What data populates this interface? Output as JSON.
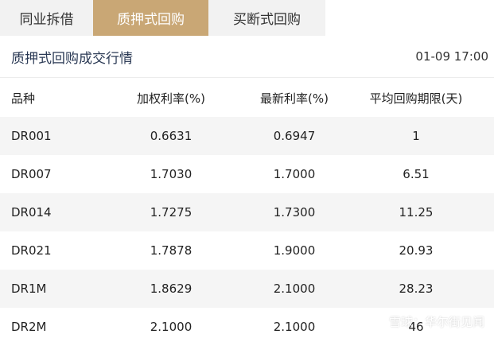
{
  "tabs": [
    {
      "label": "同业拆借",
      "active": false
    },
    {
      "label": "质押式回购",
      "active": true
    },
    {
      "label": "买断式回购",
      "active": false
    }
  ],
  "section": {
    "title": "质押式回购成交行情",
    "time": "01-09 17:00"
  },
  "table": {
    "headers": [
      "品种",
      "加权利率(%)",
      "最新利率(%)",
      "平均回购期限(天)"
    ],
    "rows": [
      [
        "DR001",
        "0.6631",
        "0.6947",
        "1"
      ],
      [
        "DR007",
        "1.7030",
        "1.7000",
        "6.51"
      ],
      [
        "DR014",
        "1.7275",
        "1.7300",
        "11.25"
      ],
      [
        "DR021",
        "1.7878",
        "1.9000",
        "20.93"
      ],
      [
        "DR1M",
        "1.8629",
        "2.1000",
        "28.23"
      ],
      [
        "DR2M",
        "2.1000",
        "2.1000",
        "46"
      ]
    ]
  },
  "watermark": {
    "text": "雪球：华尔街见闻"
  },
  "colors": {
    "accent": "#c9a775",
    "tab_bg": "#f2f2f2",
    "row_shade": "#f5f5f5",
    "title_text": "#2b3a55"
  }
}
